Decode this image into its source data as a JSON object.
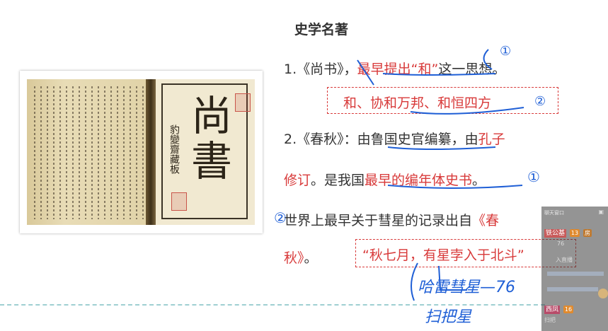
{
  "slide": {
    "heading": "史学名著",
    "line1_prefix": "1.《尚书》，",
    "line1_red": "最早提出“和”",
    "line1_suffix": "这一思想。",
    "box1_text": "和、协和万邦、和恒四方",
    "line2_prefix": "2.《春秋》：由",
    "line2_mid": "鲁国史官编纂，由",
    "line2_red": "孔子",
    "line3_red1": "修订",
    "line3_mid": "。是我国",
    "line3_red2": "最早的编年体史书",
    "line3_end": "。",
    "line4_prefix": "世界上最早关于彗星的记录出自",
    "line4_red": "《春",
    "line5_red": "秋》",
    "line5_end": "。",
    "box2_text": "“秋七月，有星孛入于北斗”"
  },
  "book": {
    "cover_title": "尚書",
    "cover_vertical": "豹變齋藏板"
  },
  "handwriting": {
    "note1": "哈雷彗星—76",
    "note2": "扫把星",
    "mark1": "①",
    "mark2": "②",
    "mark3": "①",
    "mark4": "②"
  },
  "chat": {
    "header": "聊天窗口",
    "user1_name": "铁公基",
    "user1_level": "13",
    "user1_badge": "房",
    "user1_msg": "76",
    "msg2": "入直播",
    "user2_name": "西凤",
    "user2_level": "16",
    "user2_msg": "扫把"
  },
  "colors": {
    "accent_red": "#d83a3a",
    "ink_blue": "#1f5fd6",
    "divider": "#9fcfd2"
  }
}
